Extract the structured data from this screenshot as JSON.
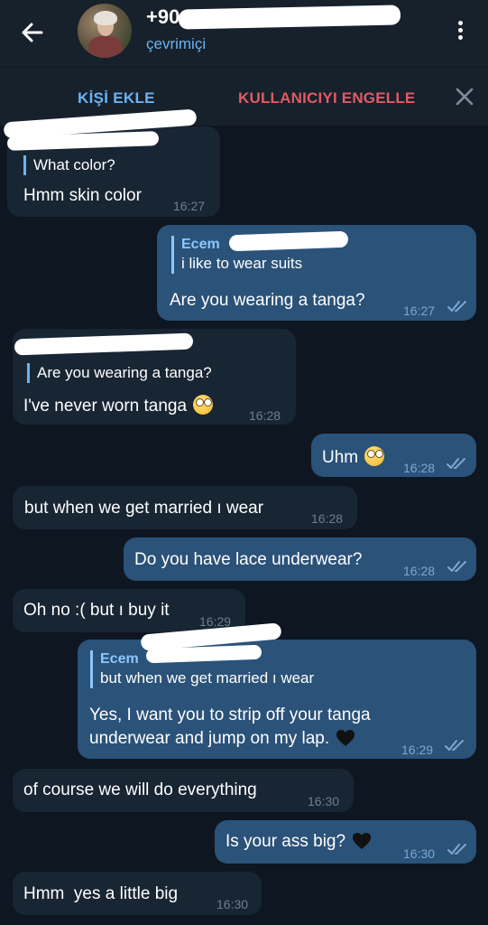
{
  "header": {
    "contact_name": "+90",
    "status": "çevrimiçi"
  },
  "actions": {
    "add_contact": "KİŞİ EKLE",
    "block_user": "KULLANICIYI ENGELLE"
  },
  "messages": [
    {
      "dir": "in",
      "reply_text": "What color?",
      "text": "Hmm skin color",
      "time": "16:27"
    },
    {
      "dir": "out",
      "reply_name": "Ecem",
      "reply_text": "i like to wear suits",
      "text": "Are you wearing a tanga?",
      "time": "16:27"
    },
    {
      "dir": "in",
      "reply_text": "Are you wearing a tanga?",
      "text": "I've never worn tanga",
      "time": "16:28"
    },
    {
      "dir": "out",
      "text": "Uhm",
      "time": "16:28"
    },
    {
      "dir": "in",
      "text": "but when we get married ı wear",
      "time": "16:28"
    },
    {
      "dir": "out",
      "text": "Do you have lace underwear?",
      "time": "16:28"
    },
    {
      "dir": "in",
      "text": "Oh no :( but ı buy it",
      "time": "16:29"
    },
    {
      "dir": "out",
      "reply_name": "Ecem",
      "reply_text": "but when we get married ı wear",
      "text_line1": "Yes, I want you to strip off your tanga",
      "text_line2": "underwear and jump on my lap.",
      "time": "16:29"
    },
    {
      "dir": "in",
      "text": "of course we will do everything",
      "time": "16:30"
    },
    {
      "dir": "out",
      "text": "Is your ass big?",
      "time": "16:30"
    },
    {
      "dir": "in",
      "text": "Hmm  yes a little big",
      "time": "16:30"
    }
  ],
  "icons": {
    "back": "arrow-left-icon",
    "menu": "more-vertical-icon",
    "close": "close-icon",
    "read": "double-check-icon",
    "emoji": "face-with-rolling-eyes",
    "heart": "black-heart"
  },
  "colors": {
    "background": "#0e1621",
    "header": "#17212b",
    "incoming": "#182533",
    "outgoing": "#2b5278",
    "accent": "#6ab3f3",
    "danger": "#e05a63"
  }
}
